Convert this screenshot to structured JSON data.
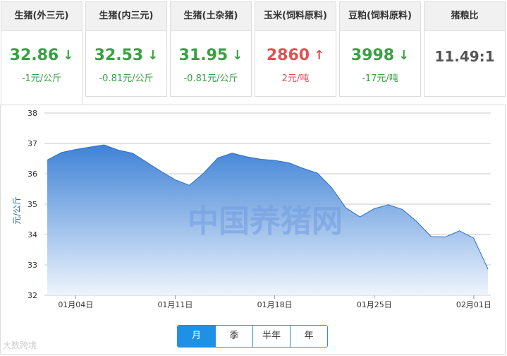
{
  "cards": [
    {
      "title": "生猪(外三元)",
      "value": "32.86",
      "arrow": "↓",
      "change": "-1元/公斤",
      "color": "#3aa043"
    },
    {
      "title": "生猪(内三元)",
      "value": "32.53",
      "arrow": "↓",
      "change": "-0.81元/公斤",
      "color": "#3aa043"
    },
    {
      "title": "生猪(土杂猪)",
      "value": "31.95",
      "arrow": "↓",
      "change": "-0.81元/公斤",
      "color": "#3aa043"
    },
    {
      "title": "玉米(饲料原料)",
      "value": "2860",
      "arrow": "↑",
      "change": "2元/吨",
      "color": "#e05252"
    },
    {
      "title": "豆粕(饲料原料)",
      "value": "3998",
      "arrow": "↓",
      "change": "-17元/吨",
      "color": "#3aa043"
    },
    {
      "title": "猪粮比",
      "value": "11.49:1"
    }
  ],
  "chart_data": {
    "type": "area",
    "ylabel": "元/公斤",
    "ylim": [
      32,
      38
    ],
    "yticks": [
      32,
      33,
      34,
      35,
      36,
      37,
      38
    ],
    "x_tick_labels": [
      "01月04日",
      "01月11日",
      "01月18日",
      "01月25日",
      "02月01日"
    ],
    "x_tick_index": [
      2,
      9,
      16,
      23,
      30
    ],
    "values": [
      36.45,
      36.7,
      36.8,
      36.88,
      36.95,
      36.78,
      36.68,
      36.38,
      36.08,
      35.8,
      35.62,
      36.02,
      36.52,
      36.68,
      36.56,
      36.48,
      36.44,
      36.36,
      36.18,
      36.02,
      35.55,
      34.88,
      34.58,
      34.85,
      34.98,
      34.82,
      34.42,
      33.93,
      33.92,
      34.12,
      33.88,
      32.86
    ],
    "grid": true,
    "colors": {
      "fill_top": "#3f82d6",
      "fill_bottom": "#eef4fc",
      "line": "#2e6fc4"
    }
  },
  "watermark": "中国养猪网",
  "source_watermark": "大数跨境",
  "period_buttons": [
    {
      "label": "月",
      "selected": true
    },
    {
      "label": "季",
      "selected": false
    },
    {
      "label": "半年",
      "selected": false
    },
    {
      "label": "年",
      "selected": false
    }
  ]
}
